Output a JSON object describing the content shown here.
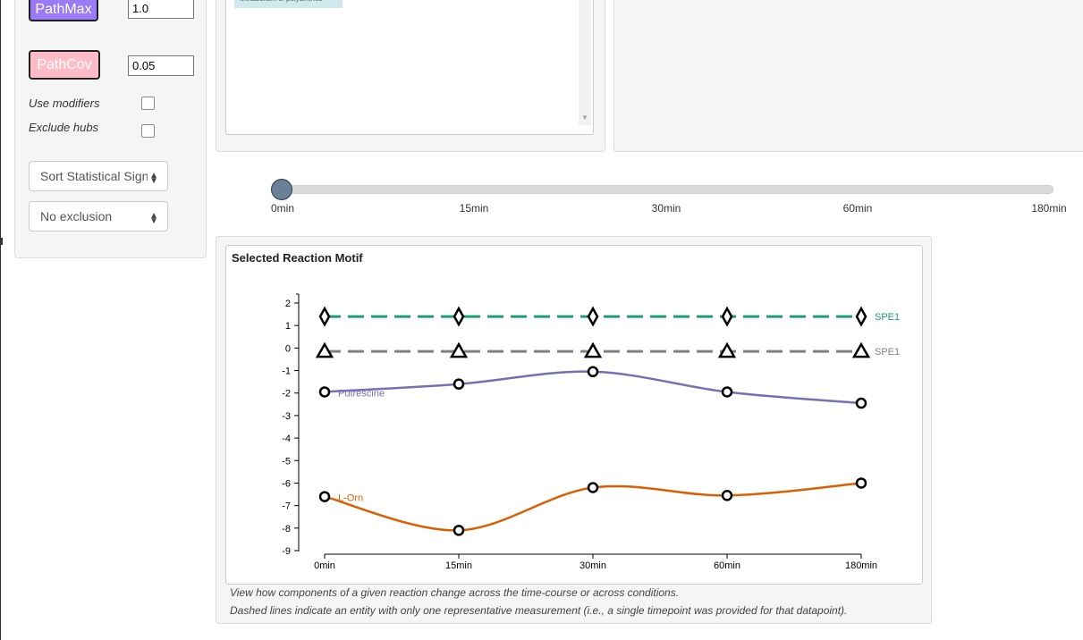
{
  "side": {
    "pathmax_label": "PathMax",
    "pathmax_value": "1.0",
    "pathcov_label": "PathCov",
    "pathcov_value": "0.05",
    "use_modifiers_label": "Use modifiers",
    "exclude_hubs_label": "Exclude hubs",
    "sort_select": "Sort Statistical Significance",
    "exclusion_select": "No exclusion"
  },
  "top_list": {
    "items": [
      "Metabolism of polyamines"
    ]
  },
  "slider": {
    "ticks": [
      "0min",
      "15min",
      "30min",
      "60min",
      "180min"
    ],
    "selected_index": 0
  },
  "chart": {
    "panel_title": "Selected Reaction Motif",
    "caption_line1": "View how components of a given reaction change across the time-course or across conditions.",
    "caption_line2": "Dashed lines indicate an entity with only one representative measurement (i.e., a single timepoint was provided for that datapoint).",
    "colors": {
      "spe1_green": "#1b9e77",
      "spe1_gray": "#808080",
      "putrescine": "#7570b3",
      "lorn": "#d95f02"
    }
  },
  "chart_data": {
    "type": "line",
    "title": "Selected Reaction Motif",
    "x": [
      "0min",
      "15min",
      "30min",
      "60min",
      "180min"
    ],
    "ylim": [
      -9,
      2
    ],
    "yticks": [
      2,
      1,
      0,
      -1,
      -2,
      -3,
      -4,
      -5,
      -6,
      -7,
      -8,
      -9
    ],
    "series": [
      {
        "name": "SPE1",
        "values": [
          1.4,
          1.4,
          1.4,
          1.4,
          1.4
        ],
        "dashed": true,
        "marker": "diamond",
        "color": "#1b9e77",
        "label_position": "end"
      },
      {
        "name": "SPE1",
        "values": [
          -0.15,
          -0.15,
          -0.15,
          -0.15,
          -0.15
        ],
        "dashed": true,
        "marker": "triangle",
        "color": "#808080",
        "label_position": "end"
      },
      {
        "name": "Putrescine",
        "values": [
          -1.95,
          -1.6,
          -1.05,
          -1.95,
          -2.45
        ],
        "dashed": false,
        "marker": "circle",
        "color": "#7570b3",
        "label_position": "start"
      },
      {
        "name": "L-Orn",
        "values": [
          -6.6,
          -8.1,
          -6.2,
          -6.55,
          -6.0
        ],
        "dashed": false,
        "marker": "circle",
        "color": "#d95f02",
        "label_position": "start"
      }
    ]
  }
}
